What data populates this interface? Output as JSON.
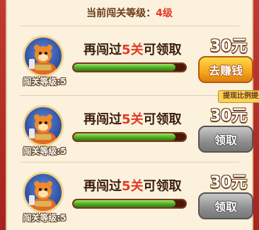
{
  "header": {
    "current_level_label": "当前闯关等级：",
    "current_level_value": "4级"
  },
  "ratio_tag": "提现比例提升",
  "tasks": [
    {
      "prefix": "再闯过",
      "number": "5关",
      "suffix": "可领取",
      "avatar_level": "闯关等级:5",
      "reward": "30元",
      "button_label": "去赚钱",
      "button_state": "active",
      "progress": 0.91
    },
    {
      "prefix": "再闯过",
      "number": "5关",
      "suffix": "可领取",
      "avatar_level": "闯关等级:5",
      "reward": "30元",
      "button_label": "领取",
      "button_state": "disabled",
      "progress": 0.91
    },
    {
      "prefix": "再闯过",
      "number": "5关",
      "suffix": "可领取",
      "avatar_level": "闯关等级:5",
      "reward": "30元",
      "button_label": "领取",
      "button_state": "disabled",
      "progress": 0.91
    }
  ],
  "colors": {
    "accent_red": "#e23b26",
    "panel_bg": "#fbf1dd",
    "go_button": "#f7a61b",
    "claim_button": "#8e8e8e",
    "progress_green": "#4eaa22"
  },
  "icons": {
    "avatar": "character-avatar-icon"
  }
}
